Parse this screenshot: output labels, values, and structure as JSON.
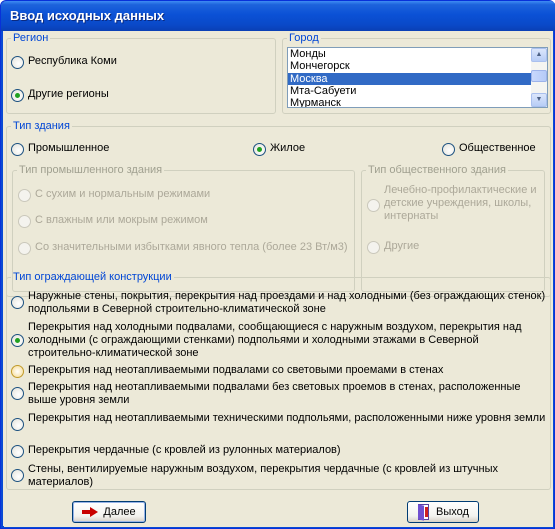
{
  "window": {
    "title": "Ввод исходных данных"
  },
  "region": {
    "legend": "Регион",
    "options": [
      "Республика Коми",
      "Другие регионы"
    ],
    "selected": 1
  },
  "city": {
    "legend": "Город",
    "items": [
      "Монды",
      "Мончегорск",
      "Москва",
      "Мта-Сабуети",
      "Мурманск"
    ],
    "selected": "Москва"
  },
  "building_type": {
    "legend": "Тип здания",
    "options": [
      "Промышленное",
      "Жилое",
      "Общественное"
    ],
    "selected": 1
  },
  "industrial_type": {
    "legend": "Тип промышленного здания",
    "options": [
      "С сухим и нормальным режимами",
      "С влажным или мокрым режимом",
      "Со значительными избытками явного тепла (более 23 Вт/м3)"
    ]
  },
  "public_type": {
    "legend": "Тип общественного здания",
    "options": [
      "Лечебно-профилактические и детские учреждения, школы, интернаты",
      "Другие"
    ]
  },
  "enclosure": {
    "legend": "Тип ограждающей конструкции",
    "options": [
      "Наружные стены, покрытия, перекрытия над проездами и над холодными (без ограждающих стенок) подпольями в Северной строительно-климатической зоне",
      "Перекрытия над холодными подвалами, сообщающиеся с наружным воздухом, перекрытия над холодными (с ограждающими стенками) подпольями и холодными этажами в Северной строительно-климатической зоне",
      "Перекрытия над неотапливаемыми подвалами со световыми проемами в стенах",
      "Перекрытия над неотапливаемыми подвалами без световых проемов в стенах, расположенные выше уровня земли",
      "Перекрытия над неотапливаемыми техническими подпольями, расположенными ниже уровня земли",
      "Перекрытия чердачные (с кровлей из рулонных материалов)",
      "Стены, вентилируемые наружным воздухом, перекрытия чердачные (с кровлей из штучных материалов)"
    ],
    "selected": 1,
    "hovered": 2
  },
  "buttons": {
    "next": "Далее",
    "exit": "Выход"
  },
  "icons": {
    "next": "red-arrow-right",
    "exit": "exit-door"
  },
  "colors": {
    "title_bar": "#0a49c8",
    "group_legend": "#0046d5",
    "selection": "#316ac5",
    "radio_dot": "#21a121"
  }
}
